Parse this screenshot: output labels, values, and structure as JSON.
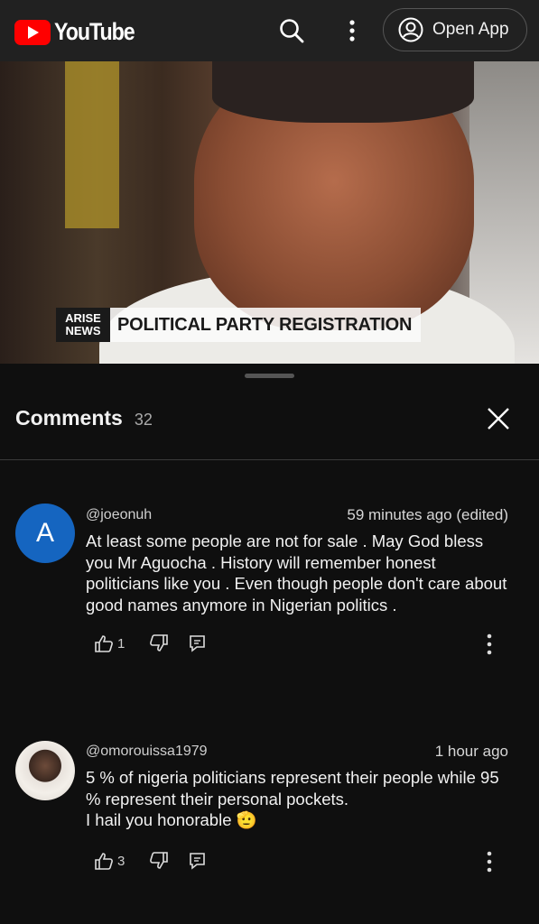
{
  "topbar": {
    "logo_text": "YouTube",
    "open_app_label": "Open App",
    "icons": [
      "youtube-logo-icon",
      "search-icon",
      "more-vert-icon",
      "account-icon"
    ]
  },
  "video": {
    "chyron_logo_top": "ARISE",
    "chyron_logo_bottom": "NEWS",
    "chyron_text": "POLITICAL PARTY REGISTRATION"
  },
  "comments": {
    "title": "Comments",
    "count": "32",
    "items": [
      {
        "avatar_letter": "A",
        "avatar_color": "#1565c0",
        "author": "@joeonuh",
        "time": "59 minutes ago (edited)",
        "text": "At least some people are not for sale . May God bless you Mr Aguocha . History will remember honest politicians like you . Even though people don't care about good names anymore in Nigerian politics .",
        "likes": "1"
      },
      {
        "author": "@omorouissa1979",
        "time": "1 hour ago",
        "text_line1": "5 % of nigeria politicians represent their people while 95 % represent their personal pockets.",
        "text_line2": "I hail you honorable",
        "emoji": "🫡",
        "likes": "3"
      }
    ]
  },
  "colors": {
    "background": "#0f0f0f",
    "topbar": "#212121",
    "youtube_red": "#ff0000"
  }
}
